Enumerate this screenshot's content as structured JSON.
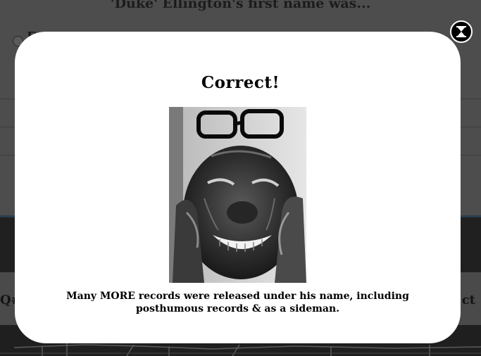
{
  "background": {
    "question": "'Duke' Ellington's first name was...",
    "option_letter": "E",
    "left_label": "Q#",
    "right_label": "ct"
  },
  "modal": {
    "title": "Correct!",
    "image_icon": "portrait-photo",
    "caption_line1": "Many MORE records were released under his name, including",
    "caption_line2": "posthumous records & as a sideman.",
    "close_icon": "close-x-icon"
  },
  "colors": {
    "overlay": "#4a4a4a",
    "modal_bg": "#ffffff",
    "text": "#000000",
    "band_border": "#2b3d50"
  }
}
